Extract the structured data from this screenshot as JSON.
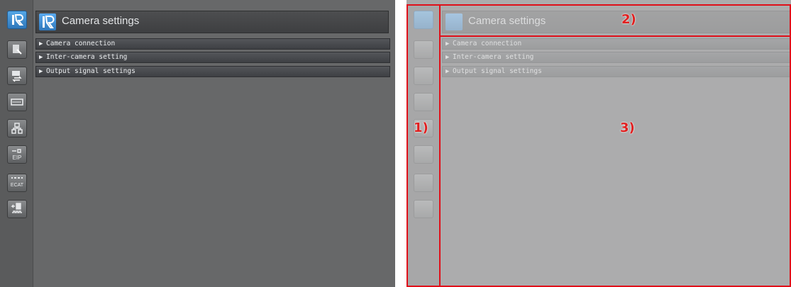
{
  "app": {
    "title": "Camera settings"
  },
  "sidebar": {
    "icons": [
      "camera-settings-icon",
      "camera-image-icon",
      "camera-transfer-icon",
      "keyboard-icon",
      "network-icon",
      "ethernet-ip-icon",
      "ethercat-icon",
      "io-signal-icon"
    ],
    "eip_label": "EIP",
    "ecat_label": "ECAT"
  },
  "sections": [
    {
      "label": "Camera connection",
      "expanded": false
    },
    {
      "label": "Inter-camera setting",
      "expanded": false
    },
    {
      "label": "Output signal settings",
      "expanded": false
    }
  ],
  "callouts": {
    "c1": "1)",
    "c2": "2)",
    "c3": "3)"
  },
  "colors": {
    "accent": "#2f78bb",
    "panel_bg": "#676869",
    "highlight": "#e0101a"
  }
}
